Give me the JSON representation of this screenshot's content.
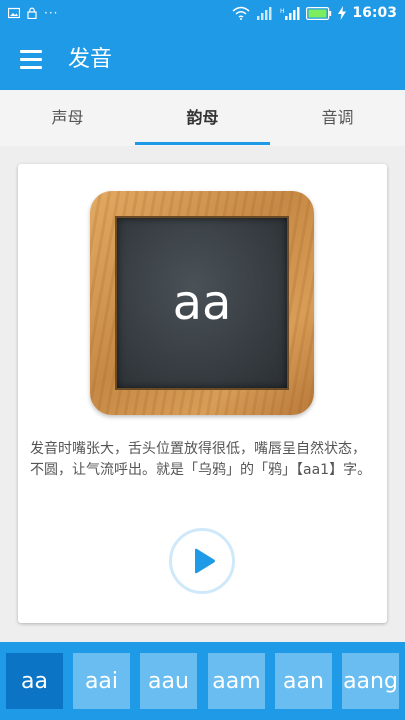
{
  "status_bar": {
    "dots": "···",
    "time": "16:03"
  },
  "app_bar": {
    "title": "发音"
  },
  "tabs": [
    {
      "label": "声母",
      "active": false
    },
    {
      "label": "韵母",
      "active": true
    },
    {
      "label": "音调",
      "active": false
    }
  ],
  "card": {
    "board_text": "aa",
    "description": "发音时嘴张大，舌头位置放得很低，嘴唇呈自然状态，不圆，让气流呼出。就是「乌鸦」的「鸦」【aa1】字。"
  },
  "bottom_bar": {
    "items": [
      "aa",
      "aai",
      "aau",
      "aam",
      "aan",
      "aang"
    ],
    "selected": "aa"
  },
  "colors": {
    "primary": "#1f9ae6",
    "chip": "#69bdf0",
    "chip_selected": "#0b74c4",
    "play_icon": "#1f9ae6"
  }
}
